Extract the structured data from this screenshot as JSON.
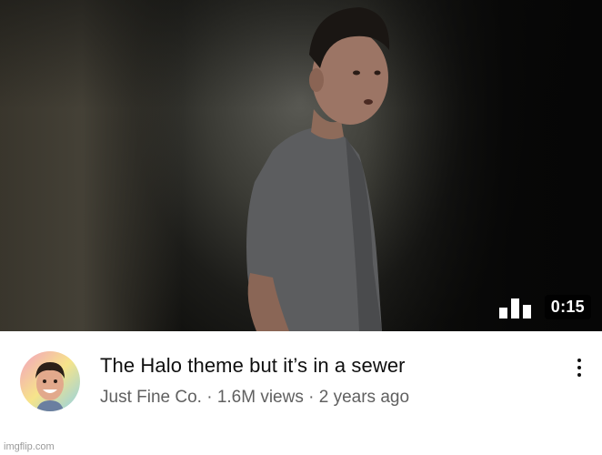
{
  "video": {
    "duration": "0:15",
    "title": "The Halo theme but it’s in a sewer",
    "meta": "Just Fine Co. · 1.6M views · 2 years ago"
  },
  "icons": {
    "audio_bars": "audio-bars-icon",
    "more": "more-vert-icon"
  },
  "watermark": "imgflip.com"
}
